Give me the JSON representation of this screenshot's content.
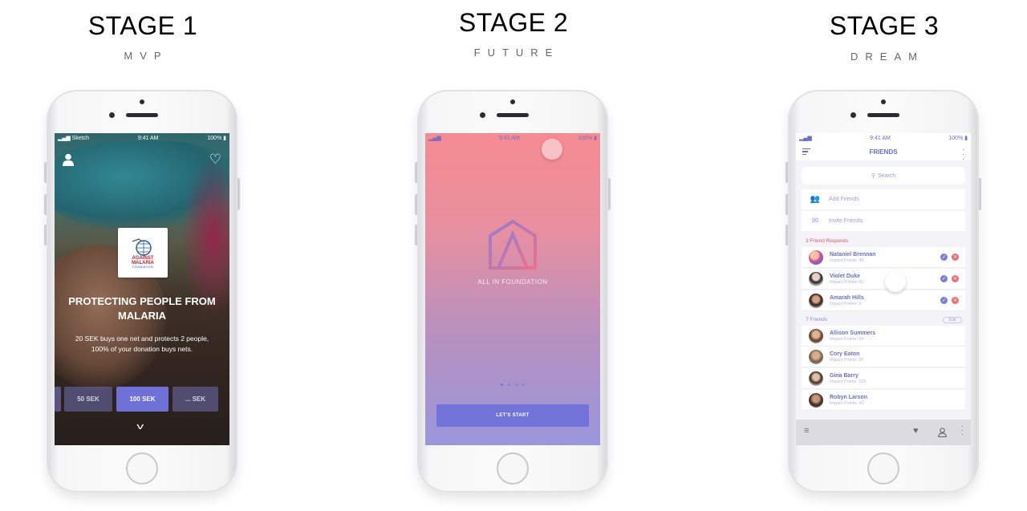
{
  "stages": [
    {
      "title": "STAGE 1",
      "subtitle": "MVP"
    },
    {
      "title": "STAGE 2",
      "subtitle": "FUTURE"
    },
    {
      "title": "STAGE 3",
      "subtitle": "DREAM"
    }
  ],
  "stage1": {
    "status": {
      "carrier": "Sketch",
      "time": "9:41 AM",
      "battery": "100%"
    },
    "logo": {
      "line1": "AGAINST",
      "line2": "MALARIA",
      "line3": "FOUNDATION"
    },
    "headline": "PROTECTING PEOPLE FROM MALARIA",
    "description": "20 SEK buys one net and protects 2 people, 100% of your donation buys nets.",
    "amounts": [
      "50 SEK",
      "100 SEK",
      "... SEK"
    ],
    "selected_amount": "100 SEK"
  },
  "stage2": {
    "status": {
      "time": "9:41 AM",
      "battery": "100%"
    },
    "brand": "ALL IN FOUNDATION",
    "page_indicator": {
      "count": 4,
      "active": 1
    },
    "cta": "LET'S START"
  },
  "stage3": {
    "status": {
      "time": "9:41 AM",
      "battery": "100%"
    },
    "title": "FRIENDS",
    "search_placeholder": "Search",
    "actions": [
      "Add Friends",
      "Invite Friends"
    ],
    "requests_label": "3 Friend Requests",
    "requests": [
      {
        "name": "Nataniel Brennan",
        "points": "Impact Points: 45"
      },
      {
        "name": "Violet Duke",
        "points": "Impact Points: 60"
      },
      {
        "name": "Amarah Hills",
        "points": "Impact Points: 0"
      }
    ],
    "friends_label": "7 Friends",
    "edit_label": "Edit",
    "friends": [
      {
        "name": "Allison Summers",
        "points": "Impact Points: 65"
      },
      {
        "name": "Cory Eaton",
        "points": "Impact Points: 20"
      },
      {
        "name": "Gina Barry",
        "points": "Impact Points: 105"
      },
      {
        "name": "Robyn Larson",
        "points": "Impact Points: 90"
      }
    ]
  },
  "colors": {
    "accent": "#6E72D8",
    "decline": "#EC6F7A",
    "request_label": "#E05A66"
  }
}
